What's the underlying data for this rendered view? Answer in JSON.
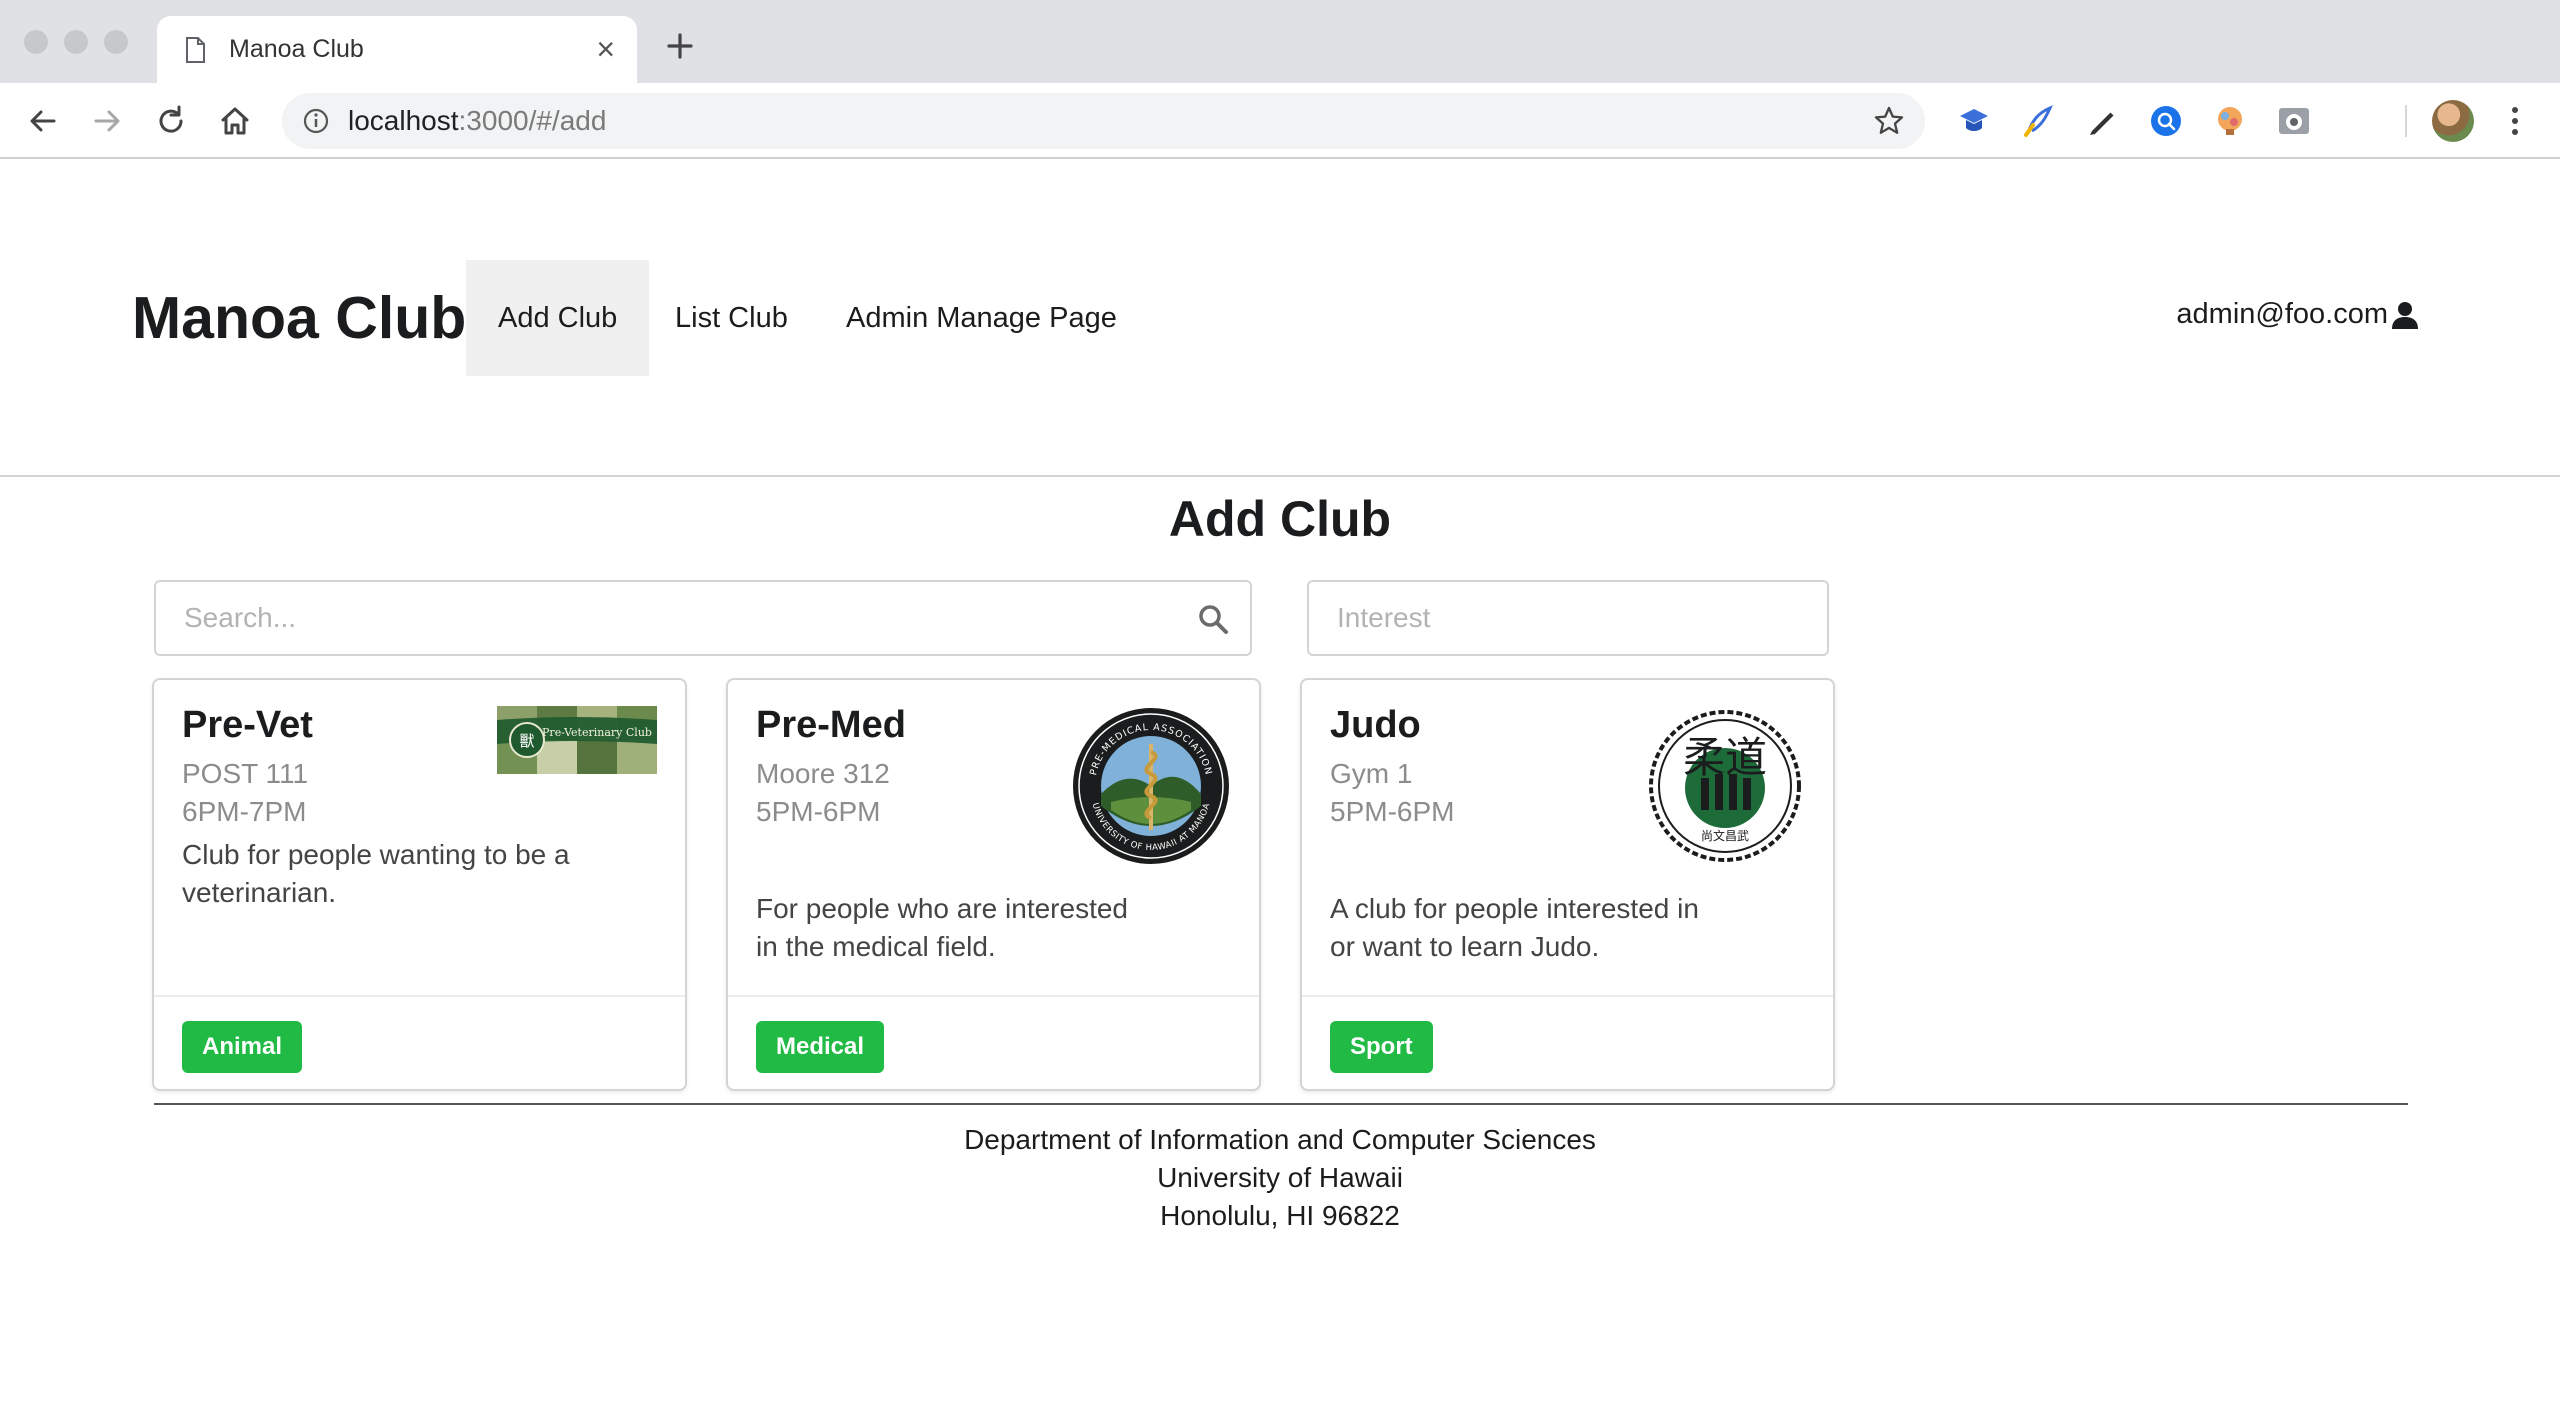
{
  "browser": {
    "tab_title": "Manoa Club",
    "url_host": "localhost",
    "url_rest": ":3000/#/add"
  },
  "navbar": {
    "brand": "Manoa Club",
    "items": [
      {
        "label": "Add Club",
        "active": true
      },
      {
        "label": "List Club",
        "active": false
      },
      {
        "label": "Admin Manage Page",
        "active": false
      }
    ],
    "user": "admin@foo.com"
  },
  "main": {
    "title": "Add Club",
    "search": {
      "placeholder": "Search..."
    },
    "interest": {
      "placeholder": "Interest"
    },
    "cards": [
      {
        "name": "Pre-Vet",
        "location": "POST 111",
        "time": "6PM-7PM",
        "description": "Club for people wanting to be a veterinarian.",
        "interest": "Animal",
        "image_text": "Pre-Veterinary Club",
        "image_glyph": "獸"
      },
      {
        "name": "Pre-Med",
        "location": "Moore 312",
        "time": "5PM-6PM",
        "description": "For people who are interested in the medical field.",
        "interest": "Medical",
        "image_text_top": "PRE-MEDICAL ASSOCIATION",
        "image_text_bottom": "UNIVERSITY OF HAWAII AT MANOA"
      },
      {
        "name": "Judo",
        "location": "Gym 1",
        "time": "5PM-6PM",
        "description": "A club for people interested in or want to learn Judo.",
        "interest": "Sport",
        "image_glyph": "柔道",
        "image_text": "尚文昌武"
      }
    ]
  },
  "footer": {
    "line1": "Department of Information and Computer Sciences",
    "line2": "University of Hawaii",
    "line3": "Honolulu, HI 96822"
  },
  "colors": {
    "label_green": "#21ba45",
    "active_nav_bg": "#f0f0f0"
  },
  "icons": [
    "page-icon",
    "close-icon",
    "plus-icon",
    "back-icon",
    "forward-icon",
    "reload-icon",
    "home-icon",
    "info-icon",
    "star-icon",
    "extension-icons",
    "avatar",
    "kebab-icon",
    "user-icon",
    "search-icon"
  ]
}
